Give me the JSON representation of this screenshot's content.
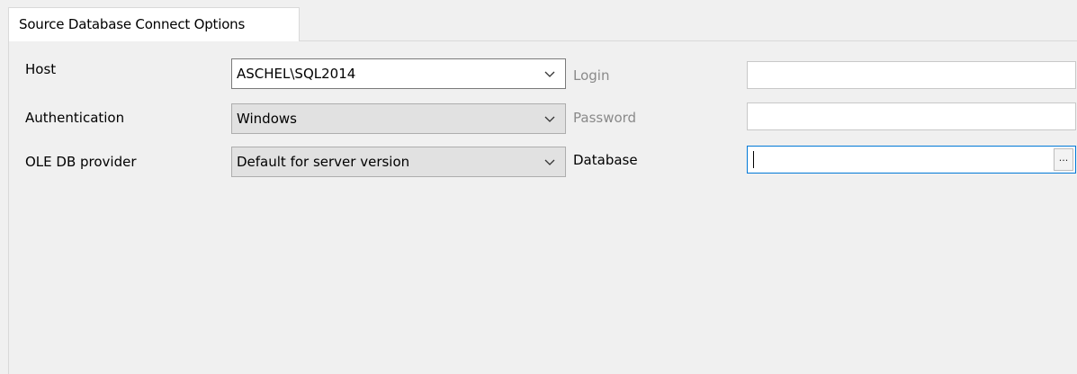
{
  "tab": {
    "label": "Source Database Connect Options"
  },
  "fields": {
    "host": {
      "label": "Host",
      "value": "ASCHEL\\SQL2014"
    },
    "authentication": {
      "label": "Authentication",
      "value": "Windows"
    },
    "provider": {
      "label": "OLE DB provider",
      "value": "Default for server version"
    },
    "login": {
      "label": "Login",
      "value": ""
    },
    "password": {
      "label": "Password",
      "value": ""
    },
    "database": {
      "label": "Database",
      "value": "",
      "browse_label": "..."
    }
  }
}
